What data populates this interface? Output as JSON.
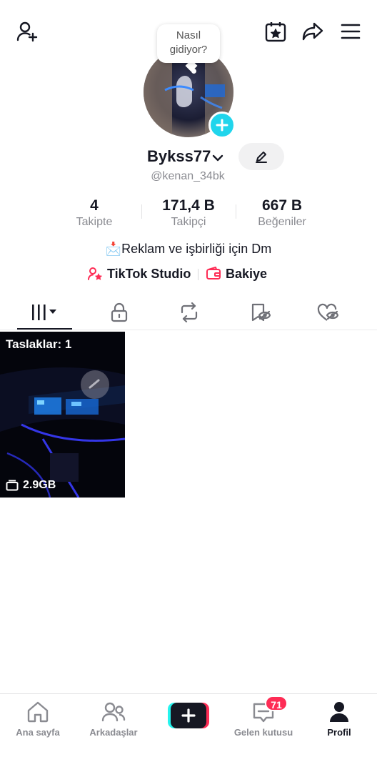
{
  "header": {
    "icons": [
      "add-friend-icon",
      "calendar-star-icon",
      "share-icon",
      "menu-icon"
    ]
  },
  "profile": {
    "bubble_text": "Nasıl gidiyor?",
    "username": "Bykss77",
    "handle": "@kenan_34bk",
    "stats": [
      {
        "value": "4",
        "label": "Takipte"
      },
      {
        "value": "171,4 B",
        "label": "Takipçi"
      },
      {
        "value": "667 B",
        "label": "Beğeniler"
      }
    ],
    "bio": "📩Reklam ve işbirliği için Dm",
    "links": {
      "studio": "TikTok Studio",
      "balance": "Bakiye"
    }
  },
  "tabs": [
    "videos-tab",
    "private-tab",
    "reposts-tab",
    "favorites-tab",
    "liked-tab"
  ],
  "grid": [
    {
      "label": "Taslaklar: 1",
      "size": "2.9GB"
    }
  ],
  "nav": {
    "home": "Ana sayfa",
    "friends": "Arkadaşlar",
    "inbox": "Gelen kutusu",
    "inbox_badge": "71",
    "profile": "Profil"
  },
  "colors": {
    "accent": "#FE2C55",
    "cyan": "#25F4EE",
    "text": "#161823",
    "muted": "#8a8b91"
  }
}
